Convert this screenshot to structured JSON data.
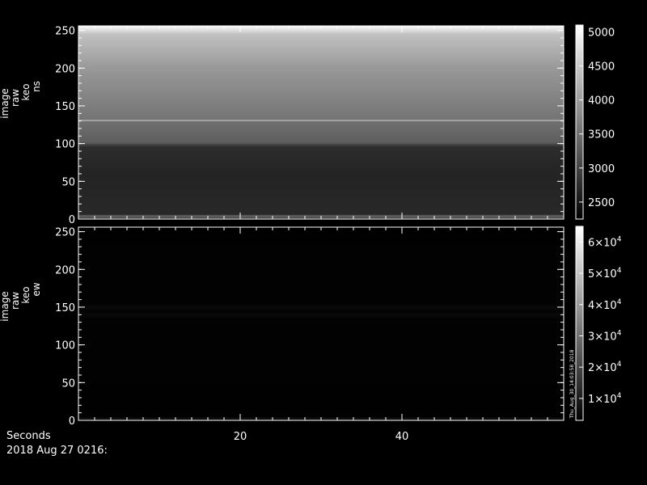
{
  "chart_data": [
    {
      "type": "heatmap",
      "name": "ns",
      "ylabel_lines": [
        "image",
        "raw",
        "keo",
        "ns"
      ],
      "ylim": [
        0,
        256
      ],
      "yticks": [
        0,
        50,
        100,
        150,
        200,
        250
      ],
      "xlim": [
        0,
        60
      ],
      "xticks_major": [
        20,
        40
      ],
      "colorbar": {
        "range": [
          2250,
          5100
        ],
        "ticks": [
          {
            "value": 2500,
            "label": "2500"
          },
          {
            "value": 3000,
            "label": "3000"
          },
          {
            "value": 3500,
            "label": "3500"
          },
          {
            "value": 4000,
            "label": "4000"
          },
          {
            "value": 4500,
            "label": "4500"
          },
          {
            "value": 5000,
            "label": "5000"
          }
        ]
      },
      "profile": [
        {
          "y": 0,
          "v": 2300
        },
        {
          "y": 4,
          "v": 3700
        },
        {
          "y": 6,
          "v": 2700
        },
        {
          "y": 60,
          "v": 2650
        },
        {
          "y": 96,
          "v": 2750
        },
        {
          "y": 102,
          "v": 3300
        },
        {
          "y": 130,
          "v": 3500
        },
        {
          "y": 131,
          "v": 4100
        },
        {
          "y": 133,
          "v": 3550
        },
        {
          "y": 200,
          "v": 3950
        },
        {
          "y": 245,
          "v": 4400
        },
        {
          "y": 252,
          "v": 4800
        },
        {
          "y": 256,
          "v": 5000
        }
      ]
    },
    {
      "type": "heatmap",
      "name": "ew",
      "ylabel_lines": [
        "image",
        "raw",
        "keo",
        "ew"
      ],
      "ylim": [
        0,
        256
      ],
      "yticks": [
        0,
        50,
        100,
        150,
        200,
        250
      ],
      "xlim": [
        0,
        60
      ],
      "xticks_major": [
        20,
        40
      ],
      "colorbar": {
        "range": [
          3000,
          65000
        ],
        "ticks": [
          {
            "value": 10000,
            "mant": "1",
            "exp": "4"
          },
          {
            "value": 20000,
            "mant": "2",
            "exp": "4"
          },
          {
            "value": 30000,
            "mant": "3",
            "exp": "4"
          },
          {
            "value": 40000,
            "mant": "4",
            "exp": "4"
          },
          {
            "value": 50000,
            "mant": "5",
            "exp": "4"
          },
          {
            "value": 60000,
            "mant": "6",
            "exp": "4"
          }
        ],
        "side_text": "Thu_Aug_30_14:03:58_2018"
      },
      "profile": [
        {
          "y": 0,
          "v": 3000
        },
        {
          "y": 3,
          "v": 7000
        },
        {
          "y": 5,
          "v": 3300
        },
        {
          "y": 135,
          "v": 3500
        },
        {
          "y": 140,
          "v": 5200
        },
        {
          "y": 145,
          "v": 3600
        },
        {
          "y": 150,
          "v": 5500
        },
        {
          "y": 155,
          "v": 3600
        },
        {
          "y": 256,
          "v": 3300
        }
      ]
    }
  ],
  "footer": {
    "xlabel": "Seconds",
    "date": "2018 Aug 27 0216:"
  }
}
